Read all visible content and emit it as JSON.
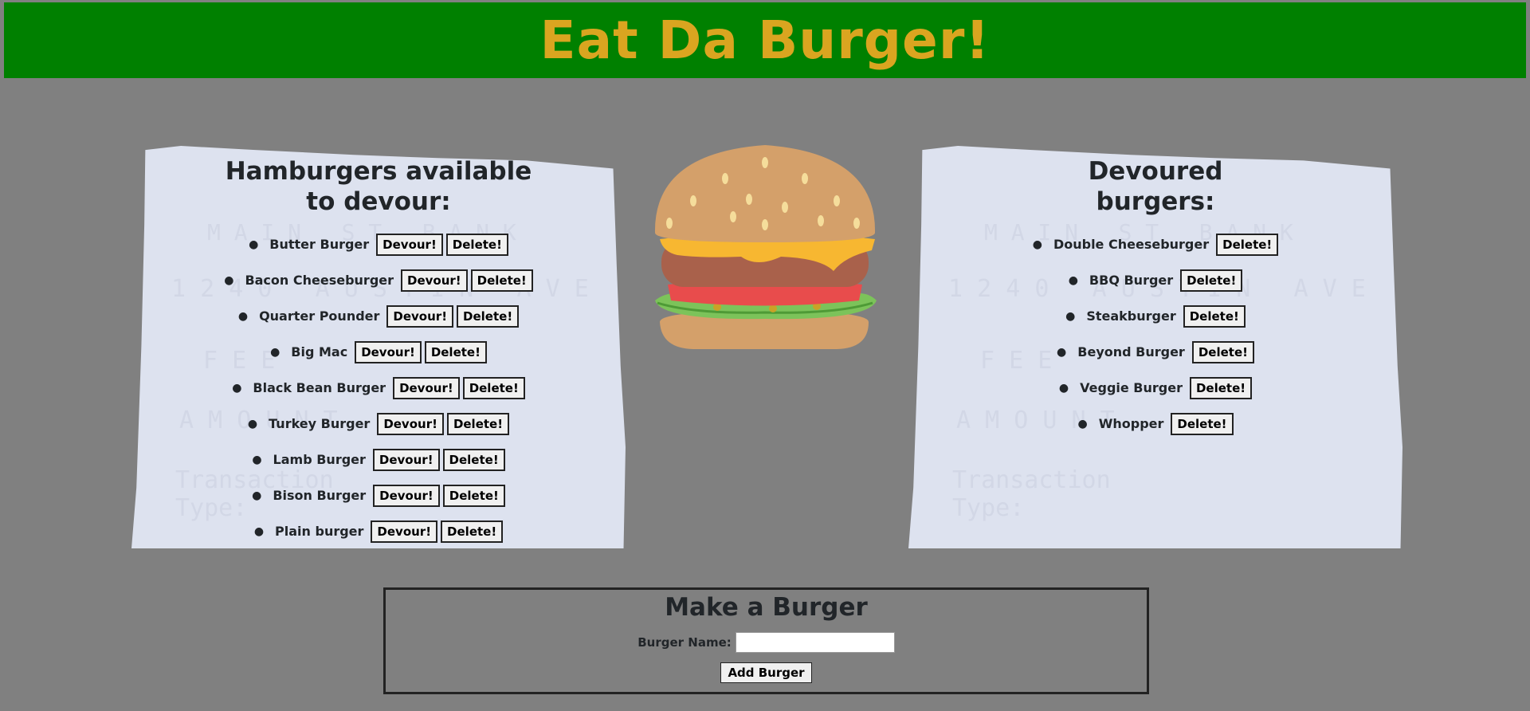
{
  "header": {
    "title": "Eat Da Burger!"
  },
  "available": {
    "title_line1": "Hamburgers available",
    "title_line2": "to devour:",
    "devour_label": "Devour!",
    "delete_label": "Delete!",
    "items": [
      "Butter Burger",
      "Bacon Cheeseburger",
      "Quarter Pounder",
      "Big Mac",
      "Black Bean Burger",
      "Turkey Burger",
      "Lamb Burger",
      "Bison Burger",
      "Plain burger"
    ]
  },
  "devoured": {
    "title_line1": "Devoured",
    "title_line2": "burgers:",
    "delete_label": "Delete!",
    "items": [
      "Double Cheeseburger",
      "BBQ Burger",
      "Steakburger",
      "Beyond Burger",
      "Veggie Burger",
      "Whopper"
    ]
  },
  "form": {
    "title": "Make a Burger",
    "name_label": "Burger Name:",
    "name_value": "",
    "submit_label": "Add Burger"
  },
  "colors": {
    "header_bg": "#008000",
    "title_color": "#DAA520",
    "page_bg": "#808080",
    "paper": "#dde2ef"
  }
}
